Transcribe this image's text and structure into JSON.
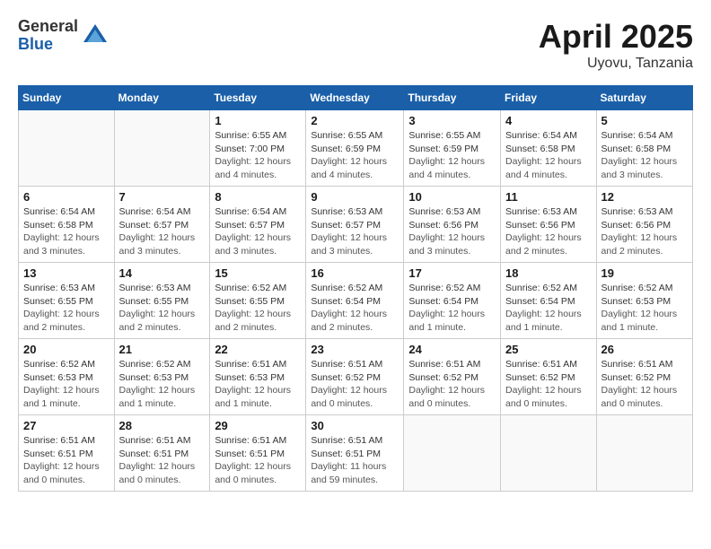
{
  "logo": {
    "general": "General",
    "blue": "Blue"
  },
  "title": {
    "month_year": "April 2025",
    "location": "Uyovu, Tanzania"
  },
  "weekdays": [
    "Sunday",
    "Monday",
    "Tuesday",
    "Wednesday",
    "Thursday",
    "Friday",
    "Saturday"
  ],
  "weeks": [
    [
      {
        "day": null
      },
      {
        "day": null
      },
      {
        "day": "1",
        "sunrise": "6:55 AM",
        "sunset": "7:00 PM",
        "daylight": "12 hours and 4 minutes."
      },
      {
        "day": "2",
        "sunrise": "6:55 AM",
        "sunset": "6:59 PM",
        "daylight": "12 hours and 4 minutes."
      },
      {
        "day": "3",
        "sunrise": "6:55 AM",
        "sunset": "6:59 PM",
        "daylight": "12 hours and 4 minutes."
      },
      {
        "day": "4",
        "sunrise": "6:54 AM",
        "sunset": "6:58 PM",
        "daylight": "12 hours and 4 minutes."
      },
      {
        "day": "5",
        "sunrise": "6:54 AM",
        "sunset": "6:58 PM",
        "daylight": "12 hours and 3 minutes."
      }
    ],
    [
      {
        "day": "6",
        "sunrise": "6:54 AM",
        "sunset": "6:58 PM",
        "daylight": "12 hours and 3 minutes."
      },
      {
        "day": "7",
        "sunrise": "6:54 AM",
        "sunset": "6:57 PM",
        "daylight": "12 hours and 3 minutes."
      },
      {
        "day": "8",
        "sunrise": "6:54 AM",
        "sunset": "6:57 PM",
        "daylight": "12 hours and 3 minutes."
      },
      {
        "day": "9",
        "sunrise": "6:53 AM",
        "sunset": "6:57 PM",
        "daylight": "12 hours and 3 minutes."
      },
      {
        "day": "10",
        "sunrise": "6:53 AM",
        "sunset": "6:56 PM",
        "daylight": "12 hours and 3 minutes."
      },
      {
        "day": "11",
        "sunrise": "6:53 AM",
        "sunset": "6:56 PM",
        "daylight": "12 hours and 2 minutes."
      },
      {
        "day": "12",
        "sunrise": "6:53 AM",
        "sunset": "6:56 PM",
        "daylight": "12 hours and 2 minutes."
      }
    ],
    [
      {
        "day": "13",
        "sunrise": "6:53 AM",
        "sunset": "6:55 PM",
        "daylight": "12 hours and 2 minutes."
      },
      {
        "day": "14",
        "sunrise": "6:53 AM",
        "sunset": "6:55 PM",
        "daylight": "12 hours and 2 minutes."
      },
      {
        "day": "15",
        "sunrise": "6:52 AM",
        "sunset": "6:55 PM",
        "daylight": "12 hours and 2 minutes."
      },
      {
        "day": "16",
        "sunrise": "6:52 AM",
        "sunset": "6:54 PM",
        "daylight": "12 hours and 2 minutes."
      },
      {
        "day": "17",
        "sunrise": "6:52 AM",
        "sunset": "6:54 PM",
        "daylight": "12 hours and 1 minute."
      },
      {
        "day": "18",
        "sunrise": "6:52 AM",
        "sunset": "6:54 PM",
        "daylight": "12 hours and 1 minute."
      },
      {
        "day": "19",
        "sunrise": "6:52 AM",
        "sunset": "6:53 PM",
        "daylight": "12 hours and 1 minute."
      }
    ],
    [
      {
        "day": "20",
        "sunrise": "6:52 AM",
        "sunset": "6:53 PM",
        "daylight": "12 hours and 1 minute."
      },
      {
        "day": "21",
        "sunrise": "6:52 AM",
        "sunset": "6:53 PM",
        "daylight": "12 hours and 1 minute."
      },
      {
        "day": "22",
        "sunrise": "6:51 AM",
        "sunset": "6:53 PM",
        "daylight": "12 hours and 1 minute."
      },
      {
        "day": "23",
        "sunrise": "6:51 AM",
        "sunset": "6:52 PM",
        "daylight": "12 hours and 0 minutes."
      },
      {
        "day": "24",
        "sunrise": "6:51 AM",
        "sunset": "6:52 PM",
        "daylight": "12 hours and 0 minutes."
      },
      {
        "day": "25",
        "sunrise": "6:51 AM",
        "sunset": "6:52 PM",
        "daylight": "12 hours and 0 minutes."
      },
      {
        "day": "26",
        "sunrise": "6:51 AM",
        "sunset": "6:52 PM",
        "daylight": "12 hours and 0 minutes."
      }
    ],
    [
      {
        "day": "27",
        "sunrise": "6:51 AM",
        "sunset": "6:51 PM",
        "daylight": "12 hours and 0 minutes."
      },
      {
        "day": "28",
        "sunrise": "6:51 AM",
        "sunset": "6:51 PM",
        "daylight": "12 hours and 0 minutes."
      },
      {
        "day": "29",
        "sunrise": "6:51 AM",
        "sunset": "6:51 PM",
        "daylight": "12 hours and 0 minutes."
      },
      {
        "day": "30",
        "sunrise": "6:51 AM",
        "sunset": "6:51 PM",
        "daylight": "11 hours and 59 minutes."
      },
      {
        "day": null
      },
      {
        "day": null
      },
      {
        "day": null
      }
    ]
  ]
}
